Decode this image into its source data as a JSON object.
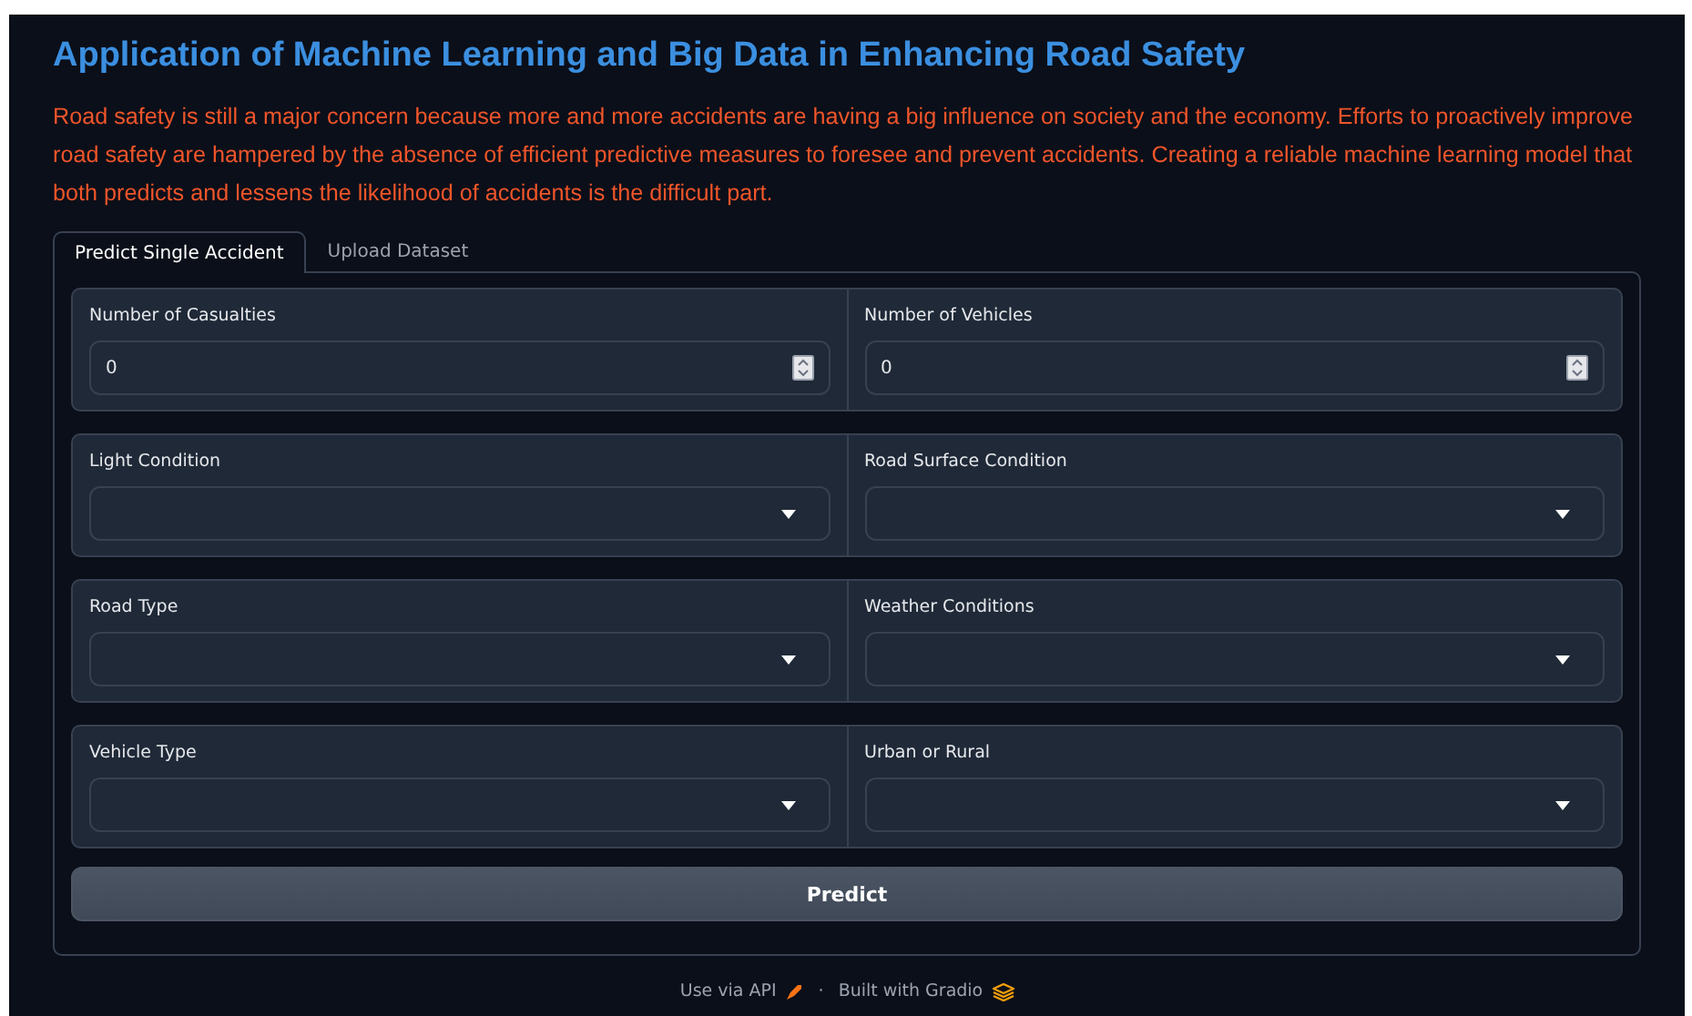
{
  "title": "Application of Machine Learning and Big Data in Enhancing Road Safety",
  "description": "Road safety is still a major concern because more and more accidents are having a big influence on society and the economy. Efforts to proactively improve road safety are hampered by the absence of efficient predictive measures to foresee and prevent accidents. Creating a reliable machine learning model that both predicts and lessens the likelihood of accidents is the difficult part.",
  "tabs": [
    {
      "label": "Predict Single Accident",
      "selected": true
    },
    {
      "label": "Upload Dataset",
      "selected": false
    }
  ],
  "rows": [
    [
      {
        "label": "Number of Casualties",
        "kind": "number",
        "value": "0"
      },
      {
        "label": "Number of Vehicles",
        "kind": "number",
        "value": "0"
      }
    ],
    [
      {
        "label": "Light Condition",
        "kind": "dropdown"
      },
      {
        "label": "Road Surface Condition",
        "kind": "dropdown"
      }
    ],
    [
      {
        "label": "Road Type",
        "kind": "dropdown"
      },
      {
        "label": "Weather Conditions",
        "kind": "dropdown"
      }
    ],
    [
      {
        "label": "Vehicle Type",
        "kind": "dropdown"
      },
      {
        "label": "Urban or Rural",
        "kind": "dropdown"
      }
    ]
  ],
  "button": "Predict",
  "footer": {
    "api": "Use via API",
    "separator": "·",
    "built": "Built with Gradio"
  }
}
